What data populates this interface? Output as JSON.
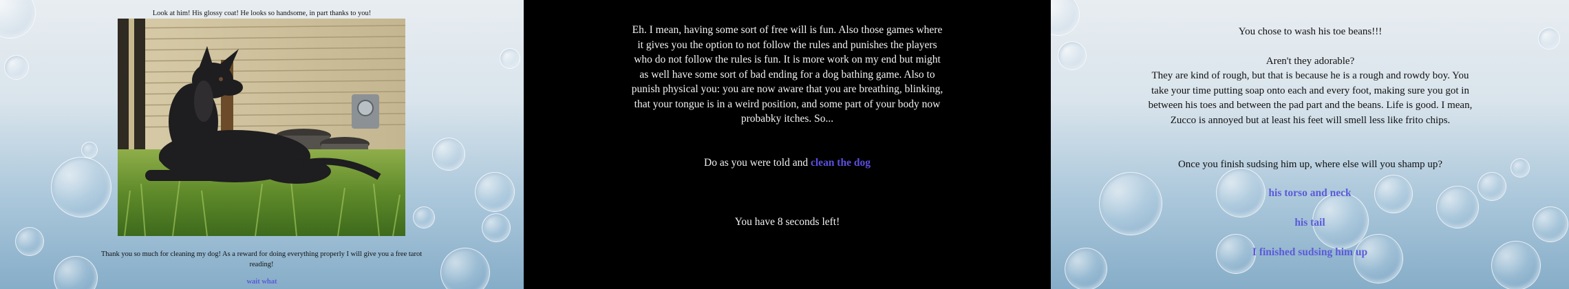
{
  "panel1": {
    "caption": "Look at him! His glossy coat! He looks so handsome, in part thanks to you!",
    "photo_icon": "dog-photo",
    "thanks_text": "Thank you so much for cleaning my dog! As a reward for doing everything properly I will give you a free tarot reading!",
    "link_label": "wait what"
  },
  "panel2": {
    "body": "Eh. I mean, having some sort of free will is fun. Also those games where it gives you the option to not follow the rules and punishes the players who do not follow the rules is fun. It is more work on my end but might as well have some sort of bad ending for a dog bathing game. Also to punish physical you: you are now aware that you are breathing, blinking, that your tongue is in a weird position, and some part of your body now probabky itches. So...",
    "choice_prefix": "Do as you were told and ",
    "choice_link": "clean the dog",
    "timer": "You have 8 seconds left!"
  },
  "panel3": {
    "line1": "You chose to wash his toe beans!!!",
    "line2": "Aren't they adorable?",
    "paragraph": "They are kind of rough, but that is because he is a rough and rowdy boy. You take your time putting soap onto each and every foot, making sure you got in between his toes and between the pad part and the beans. Life is good. I mean, Zucco is annoyed but at least his feet will smell less like frito chips.",
    "question": "Once you finish sudsing him up, where else will you shamp up?",
    "options": [
      "his torso and neck",
      "his tail",
      "I finished sudsing him up"
    ]
  },
  "colors": {
    "link_blue": "#5b4fe0",
    "panel2_bg": "#000000",
    "text_light": "#f2f2f2"
  }
}
